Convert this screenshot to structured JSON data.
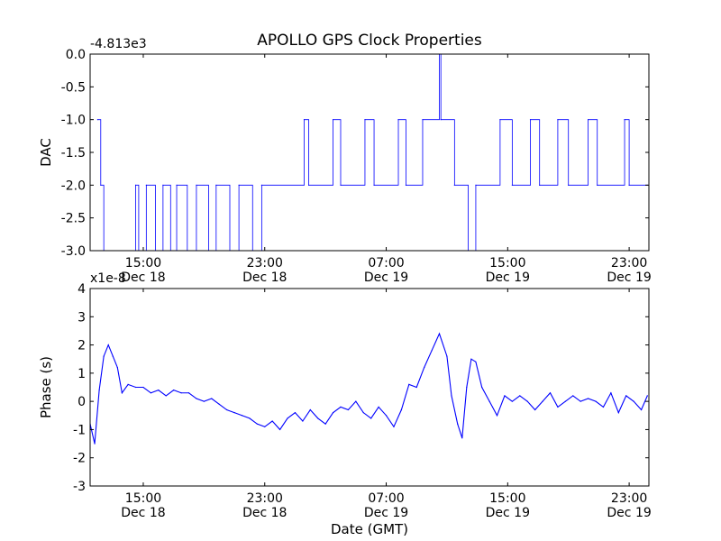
{
  "chart_data": [
    {
      "type": "line",
      "title": "APOLLO GPS Clock Properties",
      "ylabel": "DAC",
      "xlabel": "",
      "offset_label": "-4.813e3",
      "ylim": [
        -3.0,
        0.0
      ],
      "xlim_hours": [
        11.5,
        24.5
      ],
      "grid": false,
      "color": "#0000ff",
      "yticks": [
        0.0,
        -0.5,
        -1.0,
        -1.5,
        -2.0,
        -2.5,
        -3.0
      ],
      "ytick_labels": [
        "0.0",
        "-0.5",
        "-1.0",
        "-1.5",
        "-2.0",
        "-2.5",
        "-3.0"
      ],
      "xticks": [
        {
          "time": "15:00",
          "date": "Dec 18"
        },
        {
          "time": "23:00",
          "date": "Dec 18"
        },
        {
          "time": "07:00",
          "date": "Dec 19"
        },
        {
          "time": "15:00",
          "date": "Dec 19"
        },
        {
          "time": "23:00",
          "date": "Dec 19"
        }
      ],
      "series": [
        {
          "values": [
            [
              12.0,
              -1.0
            ],
            [
              12.2,
              -2.0
            ],
            [
              12.4,
              -3.0
            ],
            [
              14.5,
              -2.0
            ],
            [
              14.7,
              -3.0
            ],
            [
              15.2,
              -2.0
            ],
            [
              15.8,
              -3.0
            ],
            [
              16.3,
              -2.0
            ],
            [
              16.8,
              -3.0
            ],
            [
              17.2,
              -2.0
            ],
            [
              17.9,
              -3.0
            ],
            [
              18.5,
              -2.0
            ],
            [
              19.3,
              -3.0
            ],
            [
              19.8,
              -2.0
            ],
            [
              20.7,
              -3.0
            ],
            [
              21.3,
              -2.0
            ],
            [
              22.2,
              -3.0
            ],
            [
              22.8,
              -2.0
            ],
            [
              25.6,
              -1.0
            ],
            [
              25.9,
              -2.0
            ],
            [
              27.5,
              -1.0
            ],
            [
              28.0,
              -2.0
            ],
            [
              29.6,
              -1.0
            ],
            [
              30.2,
              -2.0
            ],
            [
              31.8,
              -1.0
            ],
            [
              32.3,
              -2.0
            ],
            [
              33.4,
              -1.0
            ],
            [
              34.5,
              -0.0
            ],
            [
              34.6,
              -1.0
            ],
            [
              35.5,
              -2.0
            ],
            [
              36.4,
              -3.0
            ],
            [
              36.9,
              -2.0
            ],
            [
              38.5,
              -1.0
            ],
            [
              39.3,
              -2.0
            ],
            [
              40.5,
              -1.0
            ],
            [
              41.1,
              -2.0
            ],
            [
              42.3,
              -1.0
            ],
            [
              43.0,
              -2.0
            ],
            [
              44.3,
              -1.0
            ],
            [
              44.9,
              -2.0
            ],
            [
              46.7,
              -1.0
            ],
            [
              47.0,
              -2.0
            ],
            [
              48.2,
              -2.0
            ]
          ]
        }
      ]
    },
    {
      "type": "line",
      "title": "",
      "ylabel": "Phase (s)",
      "xlabel": "Date (GMT)",
      "offset_label": "x1e-8",
      "ylim": [
        -3,
        4
      ],
      "grid": false,
      "color": "#0000ff",
      "yticks": [
        4,
        3,
        2,
        1,
        0,
        -1,
        -2,
        -3
      ],
      "ytick_labels": [
        "4",
        "3",
        "2",
        "1",
        "0",
        "-1",
        "-2",
        "-3"
      ],
      "xticks": [
        {
          "time": "15:00",
          "date": "Dec 18"
        },
        {
          "time": "23:00",
          "date": "Dec 18"
        },
        {
          "time": "07:00",
          "date": "Dec 19"
        },
        {
          "time": "15:00",
          "date": "Dec 19"
        },
        {
          "time": "23:00",
          "date": "Dec 19"
        }
      ],
      "series": [
        {
          "values": [
            [
              11.5,
              -0.8
            ],
            [
              11.8,
              -1.5
            ],
            [
              12.1,
              0.4
            ],
            [
              12.4,
              1.6
            ],
            [
              12.7,
              2.0
            ],
            [
              13.0,
              1.6
            ],
            [
              13.3,
              1.2
            ],
            [
              13.6,
              0.3
            ],
            [
              14.0,
              0.6
            ],
            [
              14.5,
              0.5
            ],
            [
              15.0,
              0.5
            ],
            [
              15.5,
              0.3
            ],
            [
              16.0,
              0.4
            ],
            [
              16.5,
              0.2
            ],
            [
              17.0,
              0.4
            ],
            [
              17.5,
              0.3
            ],
            [
              18.0,
              0.3
            ],
            [
              18.5,
              0.1
            ],
            [
              19.0,
              0.0
            ],
            [
              19.5,
              0.1
            ],
            [
              20.0,
              -0.1
            ],
            [
              20.5,
              -0.3
            ],
            [
              21.0,
              -0.4
            ],
            [
              21.5,
              -0.5
            ],
            [
              22.0,
              -0.6
            ],
            [
              22.5,
              -0.8
            ],
            [
              23.0,
              -0.9
            ],
            [
              23.5,
              -0.7
            ],
            [
              24.0,
              -1.0
            ],
            [
              24.5,
              -0.6
            ],
            [
              25.0,
              -0.4
            ],
            [
              25.5,
              -0.7
            ],
            [
              26.0,
              -0.3
            ],
            [
              26.5,
              -0.6
            ],
            [
              27.0,
              -0.8
            ],
            [
              27.5,
              -0.4
            ],
            [
              28.0,
              -0.2
            ],
            [
              28.5,
              -0.3
            ],
            [
              29.0,
              0.0
            ],
            [
              29.5,
              -0.4
            ],
            [
              30.0,
              -0.6
            ],
            [
              30.5,
              -0.2
            ],
            [
              31.0,
              -0.5
            ],
            [
              31.5,
              -0.9
            ],
            [
              32.0,
              -0.3
            ],
            [
              32.5,
              0.6
            ],
            [
              33.0,
              0.5
            ],
            [
              33.5,
              1.2
            ],
            [
              34.0,
              1.8
            ],
            [
              34.5,
              2.4
            ],
            [
              35.0,
              1.6
            ],
            [
              35.3,
              0.2
            ],
            [
              35.7,
              -0.8
            ],
            [
              36.0,
              -1.3
            ],
            [
              36.3,
              0.5
            ],
            [
              36.6,
              1.5
            ],
            [
              36.9,
              1.4
            ],
            [
              37.3,
              0.5
            ],
            [
              37.8,
              0.0
            ],
            [
              38.3,
              -0.5
            ],
            [
              38.8,
              0.2
            ],
            [
              39.3,
              0.0
            ],
            [
              39.8,
              0.2
            ],
            [
              40.3,
              0.0
            ],
            [
              40.8,
              -0.3
            ],
            [
              41.3,
              0.0
            ],
            [
              41.8,
              0.3
            ],
            [
              42.3,
              -0.2
            ],
            [
              42.8,
              0.0
            ],
            [
              43.3,
              0.2
            ],
            [
              43.8,
              0.0
            ],
            [
              44.3,
              0.1
            ],
            [
              44.8,
              0.0
            ],
            [
              45.3,
              -0.2
            ],
            [
              45.8,
              0.3
            ],
            [
              46.3,
              -0.4
            ],
            [
              46.8,
              0.2
            ],
            [
              47.3,
              0.0
            ],
            [
              47.8,
              -0.3
            ],
            [
              48.2,
              0.2
            ]
          ]
        }
      ]
    }
  ]
}
